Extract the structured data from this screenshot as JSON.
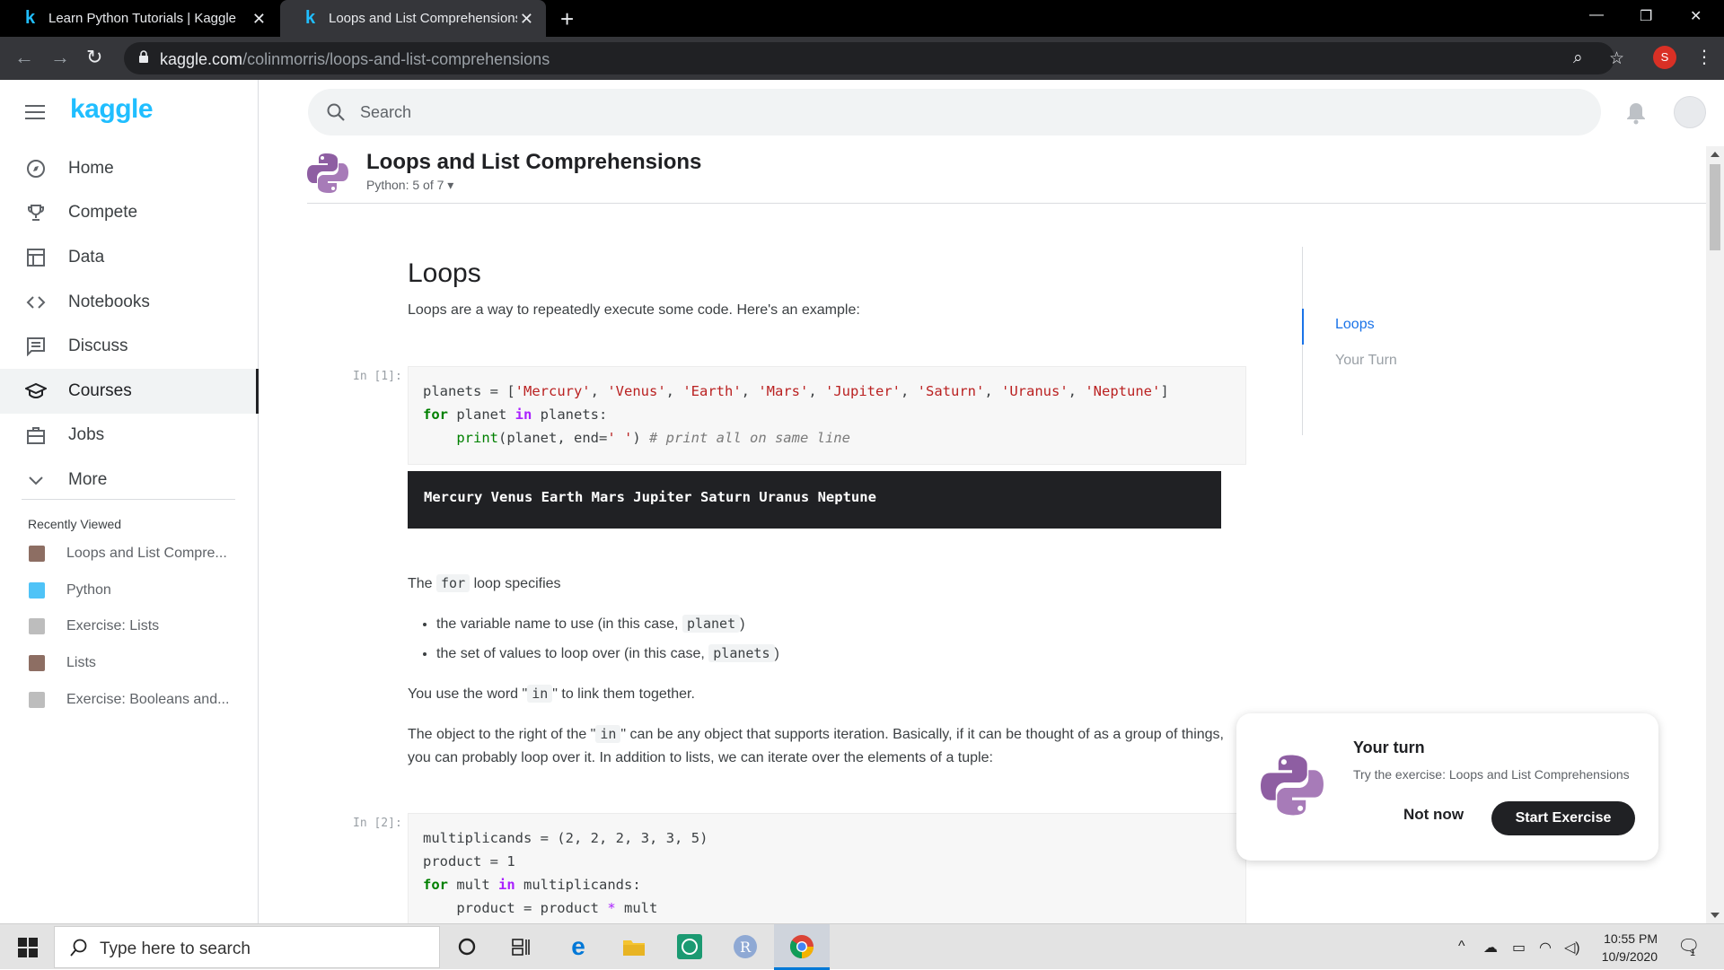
{
  "browser": {
    "tabs": [
      {
        "label": "Learn Python Tutorials | Kaggle",
        "favicon": "k"
      },
      {
        "label": "Loops and List Comprehensions | Kaggle",
        "favicon": "k"
      }
    ],
    "url_domain": "kaggle.com",
    "url_path": "/colinmorris/loops-and-list-comprehensions",
    "profile_initial": "S"
  },
  "sidebar": {
    "logo": "kaggle",
    "items": [
      {
        "label": "Home",
        "icon": "compass-icon"
      },
      {
        "label": "Compete",
        "icon": "trophy-icon"
      },
      {
        "label": "Data",
        "icon": "table-icon"
      },
      {
        "label": "Notebooks",
        "icon": "code-icon"
      },
      {
        "label": "Discuss",
        "icon": "comment-icon"
      },
      {
        "label": "Courses",
        "icon": "school-icon",
        "selected": true
      },
      {
        "label": "Jobs",
        "icon": "briefcase-icon"
      },
      {
        "label": "More",
        "icon": "chevron-down-icon"
      }
    ],
    "recent_header": "Recently Viewed",
    "recent": [
      {
        "label": "Loops and List Compre...",
        "thumb": "#8d6e63"
      },
      {
        "label": "Python",
        "thumb": "#4fc3f7"
      },
      {
        "label": "Exercise: Lists",
        "thumb": "#bdbdbd"
      },
      {
        "label": "Lists",
        "thumb": "#8d6e63"
      },
      {
        "label": "Exercise: Booleans and...",
        "thumb": "#bdbdbd"
      }
    ]
  },
  "search": {
    "placeholder": "Search"
  },
  "course": {
    "title": "Loops and List Comprehensions",
    "subtitle": "Python: 5 of 7"
  },
  "notebook": {
    "section_title": "Loops",
    "intro": "Loops are a way to repeatedly execute some code. Here's an example:",
    "cell1_prompt": "In [1]:",
    "cell1_output": "Mercury Venus Earth Mars Jupiter Saturn Uranus Neptune",
    "for_para_pre": "The",
    "for_para_code": "for",
    "for_para_post": "loop specifies",
    "bullets": [
      {
        "pre": "the variable name to use (in this case,",
        "code": "planet",
        "post": ")"
      },
      {
        "pre": "the set of values to loop over (in this case,",
        "code": "planets",
        "post": ")"
      }
    ],
    "in_para_pre": "You use the word \"",
    "in_para_code": "in",
    "in_para_post": "\" to link them together.",
    "object_para_pre": "The object to the right of the \"",
    "object_para_code": "in",
    "object_para_post": "\" can be any object that supports iteration. Basically, if it can be thought of as a group of things, you can probably loop over it. In addition to lists, we can iterate over the elements of a tuple:",
    "cell2_prompt": "In [2]:"
  },
  "toc": [
    {
      "label": "Loops",
      "active": true
    },
    {
      "label": "Your Turn",
      "active": false
    }
  ],
  "card": {
    "title": "Your turn",
    "subtitle": "Try the exercise: Loops and List Comprehensions",
    "not_now": "Not now",
    "start": "Start Exercise"
  },
  "taskbar": {
    "search_placeholder": "Type here to search",
    "time": "10:55 PM",
    "date": "10/9/2020",
    "notification_count": "1"
  },
  "colors": {
    "accent": "#20beff",
    "link": "#1a73e8",
    "dark": "#202124"
  }
}
